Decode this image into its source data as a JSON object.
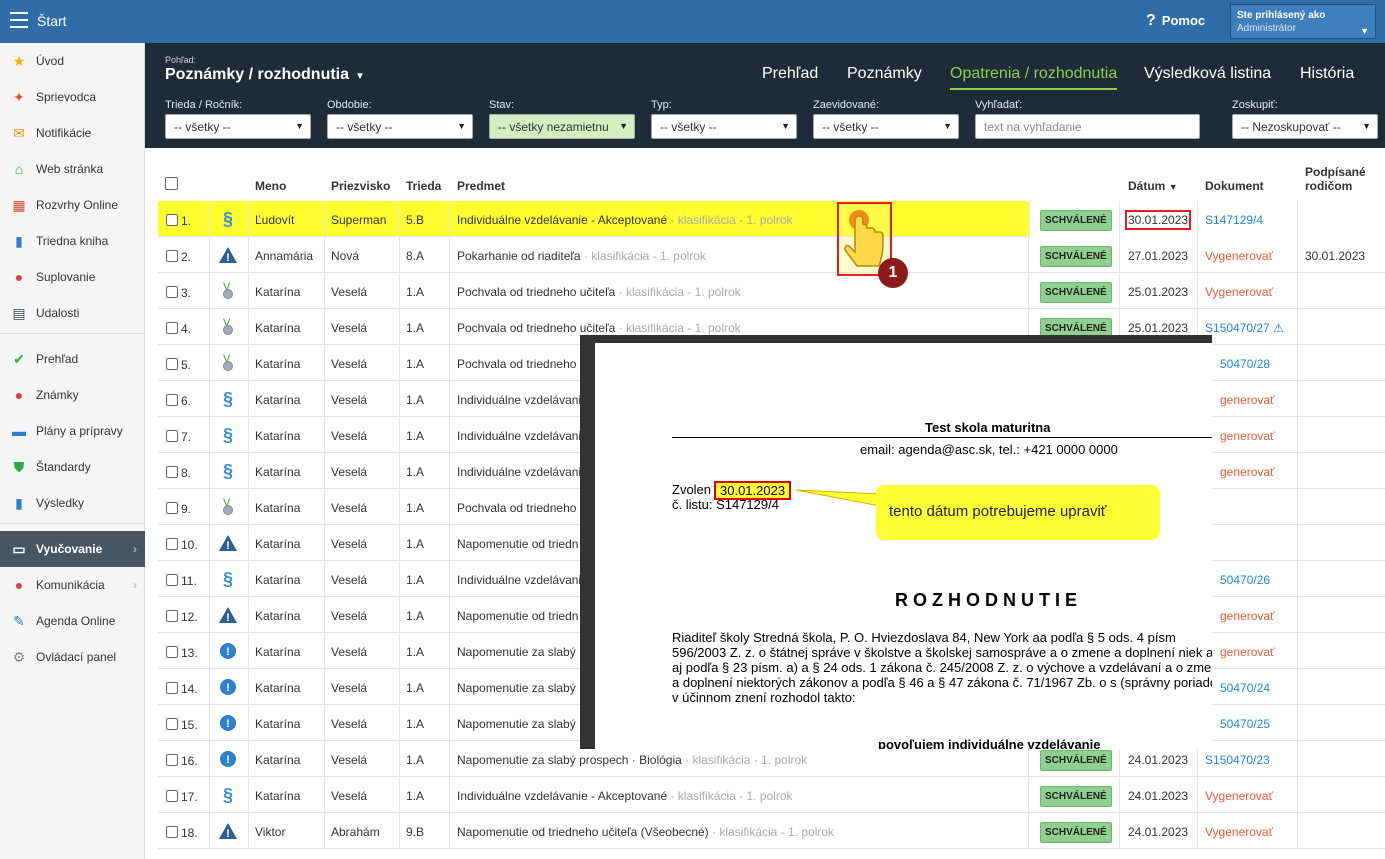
{
  "topbar": {
    "app_title": "Štart",
    "help": "Pomoc",
    "user_line1": "Ste prihlásený ako",
    "user_line2": "Administrátor"
  },
  "sidebar": [
    {
      "label": "Úvod",
      "icon": "star-icon"
    },
    {
      "label": "Sprievodca",
      "icon": "wizard-icon"
    },
    {
      "label": "Notifikácie",
      "icon": "mail-icon"
    },
    {
      "label": "Web stránka",
      "icon": "home-icon"
    },
    {
      "label": "Rozvrhy Online",
      "icon": "timetable-icon"
    },
    {
      "label": "Triedna kniha",
      "icon": "book-icon"
    },
    {
      "label": "Suplovanie",
      "icon": "person-icon"
    },
    {
      "label": "Udalosti",
      "icon": "calendar-icon"
    },
    {
      "label": "Prehľad",
      "icon": "check-icon"
    },
    {
      "label": "Známky",
      "icon": "grade-icon"
    },
    {
      "label": "Plány a prípravy",
      "icon": "briefcase-icon"
    },
    {
      "label": "Štandardy",
      "icon": "shield-icon"
    },
    {
      "label": "Výsledky",
      "icon": "barchart-icon"
    },
    {
      "label": "Vyučovanie",
      "icon": "open-book-icon"
    },
    {
      "label": "Komunikácia",
      "icon": "chat-icon"
    },
    {
      "label": "Agenda Online",
      "icon": "pen-icon"
    },
    {
      "label": "Ovládací panel",
      "icon": "gear-icon"
    }
  ],
  "view": {
    "small": "Pohľad:",
    "title": "Poznámky / rozhodnutia"
  },
  "tabs": [
    "Prehľad",
    "Poznámky",
    "Opatrenia / rozhodnutia",
    "Výsledková listina",
    "História"
  ],
  "filters": [
    {
      "label": "Trieda / Ročník:",
      "value": "-- všetky --"
    },
    {
      "label": "Obdobie:",
      "value": "-- všetky --"
    },
    {
      "label": "Stav:",
      "value": "-- všetky nezamietnu"
    },
    {
      "label": "Typ:",
      "value": "-- všetky --"
    },
    {
      "label": "Zaevidované:",
      "value": "-- všetky --"
    },
    {
      "label": "Vyhľadať:",
      "placeholder": "text na vyhľadanie"
    },
    {
      "label": "Zoskupiť:",
      "value": "-- Nezoskupovať --"
    }
  ],
  "columns": {
    "meno": "Meno",
    "priezvisko": "Priezvisko",
    "trieda": "Trieda",
    "predmet": "Predmet",
    "datum": "Dátum",
    "dokument": "Dokument",
    "podpisane1": "Podpísané",
    "podpisane2": "rodičom"
  },
  "rows": [
    {
      "n": "1.",
      "icon": "§",
      "meno": "Ľudovít",
      "priez": "Superman",
      "trieda": "5.B",
      "pred": "Individuálne vzdelávanie - Akceptované",
      "sub": " · klasifikácia - 1. polrok",
      "badge": "SCHVÁLENÉ",
      "datum": "30.01.2023",
      "dok": "S147129/4",
      "podp": ""
    },
    {
      "n": "2.",
      "icon": "▲",
      "meno": "Annamária",
      "priez": "Nová",
      "trieda": "8.A",
      "pred": "Pokarhanie od riaditeľa",
      "sub": " · klasifikácia - 1. polrok",
      "badge": "SCHVÁLENÉ",
      "datum": "27.01.2023",
      "dok": "Vygenerovať",
      "podp": "30.01.2023"
    },
    {
      "n": "3.",
      "icon": "medal",
      "meno": "Katarína",
      "priez": "Veselá",
      "trieda": "1.A",
      "pred": "Pochvala od triedneho učiteľa",
      "sub": " · klasifikácia - 1. polrok",
      "badge": "SCHVÁLENÉ",
      "datum": "25.01.2023",
      "dok": "Vygenerovať",
      "podp": ""
    },
    {
      "n": "4.",
      "icon": "medal",
      "meno": "Katarína",
      "priez": "Veselá",
      "trieda": "1.A",
      "pred": "Pochvala od triedneho učiteľa",
      "sub": " · klasifikácia - 1. polrok",
      "badge": "SCHVÁLENÉ",
      "datum": "25.01.2023",
      "dok": "S150470/27 ⚠",
      "podp": ""
    },
    {
      "n": "5.",
      "icon": "medal",
      "meno": "Katarína",
      "priez": "Veselá",
      "trieda": "1.A",
      "pred": "Pochvala od triedneho",
      "sub": "",
      "badge": "",
      "datum": "",
      "dok": "50470/28",
      "podp": ""
    },
    {
      "n": "6.",
      "icon": "§",
      "meno": "Katarína",
      "priez": "Veselá",
      "trieda": "1.A",
      "pred": "Individuálne vzdelávani",
      "sub": "",
      "badge": "",
      "datum": "",
      "dok": "generovať",
      "podp": ""
    },
    {
      "n": "7.",
      "icon": "§",
      "meno": "Katarína",
      "priez": "Veselá",
      "trieda": "1.A",
      "pred": "Individuálne vzdelávani",
      "sub": "",
      "badge": "",
      "datum": "",
      "dok": "generovať",
      "podp": ""
    },
    {
      "n": "8.",
      "icon": "§",
      "meno": "Katarína",
      "priez": "Veselá",
      "trieda": "1.A",
      "pred": "Individuálne vzdelávani",
      "sub": "",
      "badge": "",
      "datum": "",
      "dok": "generovať",
      "podp": ""
    },
    {
      "n": "9.",
      "icon": "medal",
      "meno": "Katarína",
      "priez": "Veselá",
      "trieda": "1.A",
      "pred": "Pochvala od triedneho",
      "sub": "",
      "badge": "",
      "datum": "",
      "dok": "",
      "podp": ""
    },
    {
      "n": "10.",
      "icon": "▲",
      "meno": "Katarína",
      "priez": "Veselá",
      "trieda": "1.A",
      "pred": "Napomenutie od triedn",
      "sub": "",
      "badge": "",
      "datum": "",
      "dok": "",
      "podp": ""
    },
    {
      "n": "11.",
      "icon": "§",
      "meno": "Katarína",
      "priez": "Veselá",
      "trieda": "1.A",
      "pred": "Individuálne vzdelávani",
      "sub": "",
      "badge": "",
      "datum": "",
      "dok": "50470/26",
      "podp": ""
    },
    {
      "n": "12.",
      "icon": "▲",
      "meno": "Katarína",
      "priez": "Veselá",
      "trieda": "1.A",
      "pred": "Napomenutie od triedn",
      "sub": "",
      "badge": "",
      "datum": "",
      "dok": "generovať",
      "podp": ""
    },
    {
      "n": "13.",
      "icon": "!",
      "meno": "Katarína",
      "priez": "Veselá",
      "trieda": "1.A",
      "pred": "Napomenutie za slabý",
      "sub": "",
      "badge": "",
      "datum": "",
      "dok": "generovať",
      "podp": ""
    },
    {
      "n": "14.",
      "icon": "!",
      "meno": "Katarína",
      "priez": "Veselá",
      "trieda": "1.A",
      "pred": "Napomenutie za slabý",
      "sub": "",
      "badge": "",
      "datum": "",
      "dok": "50470/24",
      "podp": ""
    },
    {
      "n": "15.",
      "icon": "!",
      "meno": "Katarína",
      "priez": "Veselá",
      "trieda": "1.A",
      "pred": "Napomenutie za slabý",
      "sub": "",
      "badge": "",
      "datum": "",
      "dok": "50470/25",
      "podp": ""
    },
    {
      "n": "16.",
      "icon": "!",
      "meno": "Katarína",
      "priez": "Veselá",
      "trieda": "1.A",
      "pred": "Napomenutie za slabý prospech · Biológia",
      "sub": " · klasifikácia - 1. polrok",
      "badge": "SCHVÁLENÉ",
      "datum": "24.01.2023",
      "dok": "S150470/23",
      "podp": ""
    },
    {
      "n": "17.",
      "icon": "§",
      "meno": "Katarína",
      "priez": "Veselá",
      "trieda": "1.A",
      "pred": "Individuálne vzdelávanie - Akceptované",
      "sub": " · klasifikácia - 1. polrok",
      "badge": "SCHVÁLENÉ",
      "datum": "24.01.2023",
      "dok": "Vygenerovať",
      "podp": ""
    },
    {
      "n": "18.",
      "icon": "▲",
      "meno": "Viktor",
      "priez": "Abrahám",
      "trieda": "9.B",
      "pred": "Napomenutie od triedneho učiteľa (Všeobecné)",
      "sub": " · klasifikácia - 1. polrok",
      "badge": "SCHVÁLENÉ",
      "datum": "24.01.2023",
      "dok": "Vygenerovať",
      "podp": ""
    }
  ],
  "document": {
    "school": "Test skola maturitna",
    "contact": "email: agenda@asc.sk, tel.: +421 0000 0000",
    "zvolen": "Zvolen",
    "zvolen_date": "30.01.2023",
    "cislo": "č. listu: S147129/4",
    "heading": "ROZHODNUTIE",
    "paragraph": "Riaditeľ školy Stredná škola, P. O. Hviezdoslava 84, New York aa podľa § 5 ods. 4 písm 596/2003 Z. z. o štátnej správe v školstve a školskej samospráve a o zmene a doplnení niek ako aj podľa § 23 písm. a) a § 24 ods. 1 zákona č. 245/2008 Z. z. o výchove a vzdelávaní a o zmene a doplnení niektorých zákonov a podľa § 46 a § 47 zákona č. 71/1967 Zb. o s (správny poriadok) v účinnom znení rozhodol takto:",
    "povolujem": "povoľujem individuálne vzdelávanie"
  },
  "annotation": {
    "callout": "tento dátum potrebujeme upraviť",
    "step": "1"
  }
}
